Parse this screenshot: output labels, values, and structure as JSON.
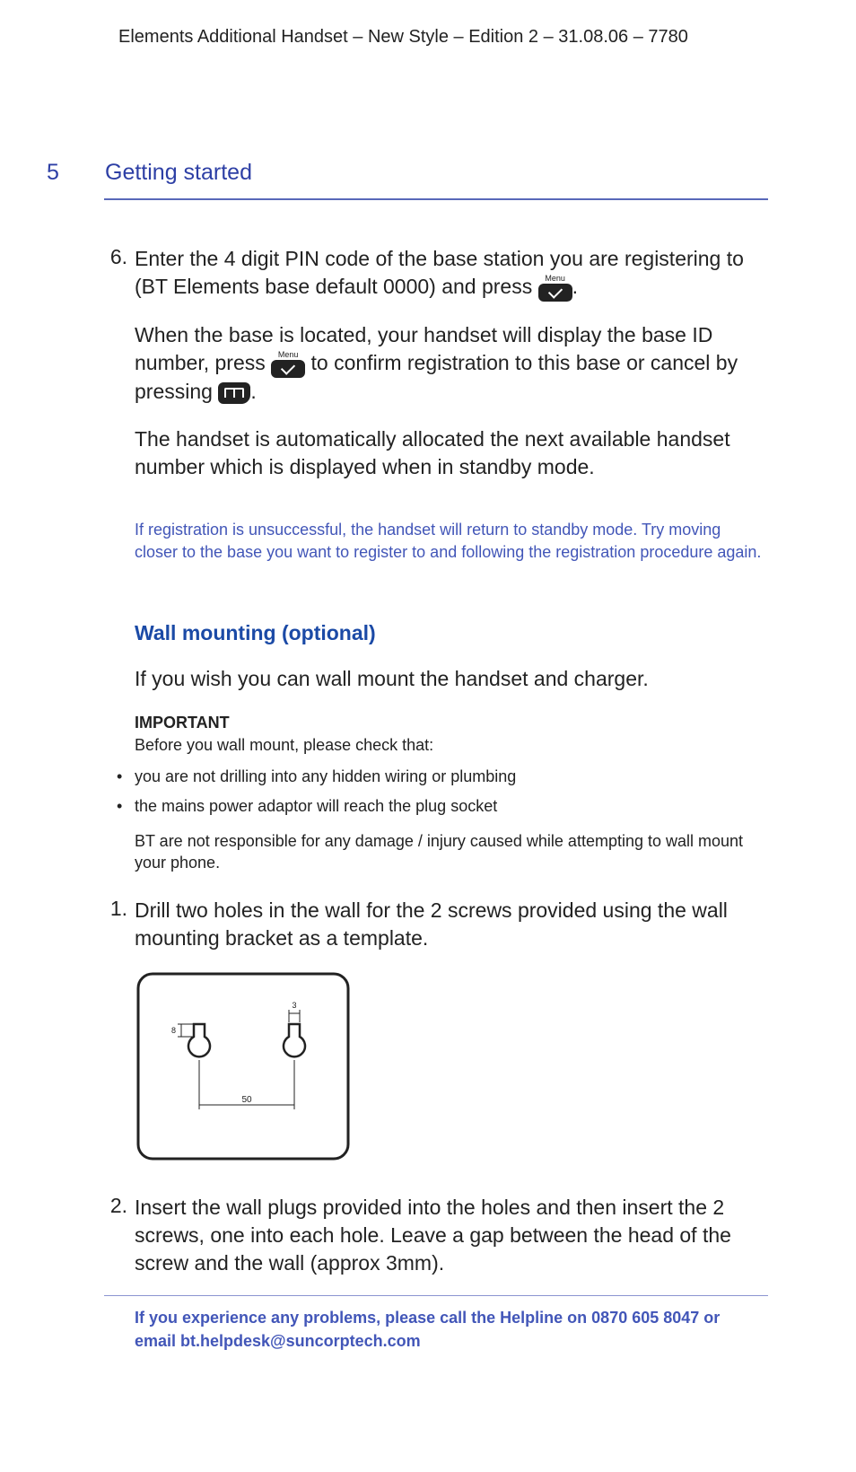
{
  "header": "Elements Additional Handset – New Style – Edition 2 – 31.08.06 – 7780",
  "page_number": "5",
  "section_title": "Getting started",
  "step6": {
    "num": "6.",
    "p1_a": "Enter the 4 digit PIN code of the base station you are registering to (BT Elements base default 0000) and press ",
    "p1_b": ".",
    "p2_a": "When the base is located, your handset will display the base ID number, press ",
    "p2_b": " to confirm registration to this base or cancel by pressing ",
    "p2_c": ".",
    "p3": "The handset is automatically allocated the next available handset number which is displayed when in standby mode."
  },
  "menu_label": "Menu",
  "note": "If registration is unsuccessful, the handset will return to standby mode. Try moving closer to the base you want to register to and following the registration procedure again.",
  "wall": {
    "heading": "Wall mounting (optional)",
    "intro": "If you wish you can wall mount the handset and charger.",
    "important_title": "IMPORTANT",
    "important_line": "Before you wall mount, please check that:",
    "b1": "you are not drilling into any hidden wiring or plumbing",
    "b2": "the mains power adaptor will reach the plug socket",
    "disclaimer": "BT are not responsible for any damage / injury caused while attempting to wall mount your phone."
  },
  "step1": {
    "num": "1.",
    "text": "Drill two holes in the wall for the 2 screws provided using the wall mounting bracket as a template."
  },
  "step2": {
    "num": "2.",
    "text": "Insert the wall plugs provided into the holes and then insert the 2 screws, one into each hole.  Leave a gap between the head of the screw and the wall (approx 3mm)."
  },
  "diagram": {
    "w": "50",
    "h": "8",
    "lip": "3"
  },
  "footer": "If you experience any problems, please call the Helpline on 0870 605 8047 or email bt.helpdesk@suncorptech.com"
}
